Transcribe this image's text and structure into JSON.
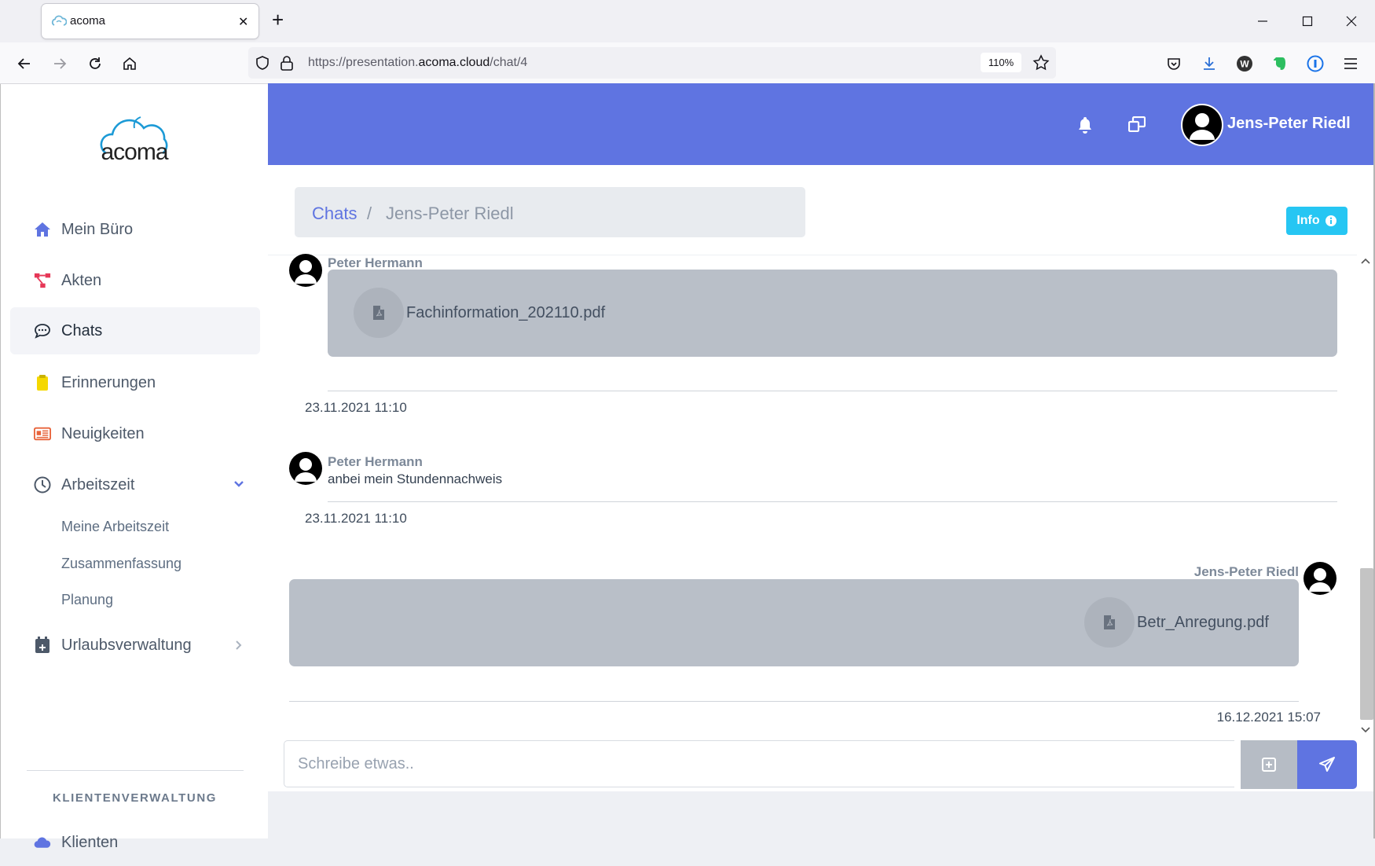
{
  "browser": {
    "tab_title": "acoma",
    "url_prefix": "https://presentation.",
    "url_host": "acoma.cloud",
    "url_path": "/chat/4",
    "zoom": "110%"
  },
  "sidebar": {
    "logo_text": "acoma",
    "items": [
      {
        "label": "Mein Büro",
        "icon": "home-icon"
      },
      {
        "label": "Akten",
        "icon": "network-icon"
      },
      {
        "label": "Chats",
        "icon": "chat-icon"
      },
      {
        "label": "Erinnerungen",
        "icon": "clipboard-icon"
      },
      {
        "label": "Neuigkeiten",
        "icon": "newspaper-icon"
      },
      {
        "label": "Arbeitszeit",
        "icon": "clock-icon"
      },
      {
        "label": "Urlaubsverwaltung",
        "icon": "calendar-plus-icon"
      }
    ],
    "arbeitszeit_sub": [
      "Meine Arbeitszeit",
      "Zusammenfassung",
      "Planung"
    ],
    "section_label": "KLIENTENVERWALTUNG",
    "klienten_label": "Klienten"
  },
  "header": {
    "user_name": "Jens-Peter Riedl"
  },
  "breadcrumb": {
    "root": "Chats",
    "separator": "/",
    "current": "Jens-Peter Riedl"
  },
  "info_button": {
    "label": "Info"
  },
  "messages": [
    {
      "sender": "Peter Hermann",
      "file": "Fachinformation_202110.pdf",
      "time": "23.11.2021 11:10"
    },
    {
      "sender": "Peter Hermann",
      "text": "anbei mein Stundennachweis",
      "time": "23.11.2021 11:10"
    },
    {
      "sender": "Jens-Peter Riedl",
      "file": "Betr_Anregung.pdf",
      "time": "16.12.2021 15:07"
    }
  ],
  "composer": {
    "placeholder": "Schreibe etwas.."
  },
  "colors": {
    "accent": "#5f74e1",
    "info": "#26c6f3",
    "file_bubble": "#b9bfc8"
  }
}
